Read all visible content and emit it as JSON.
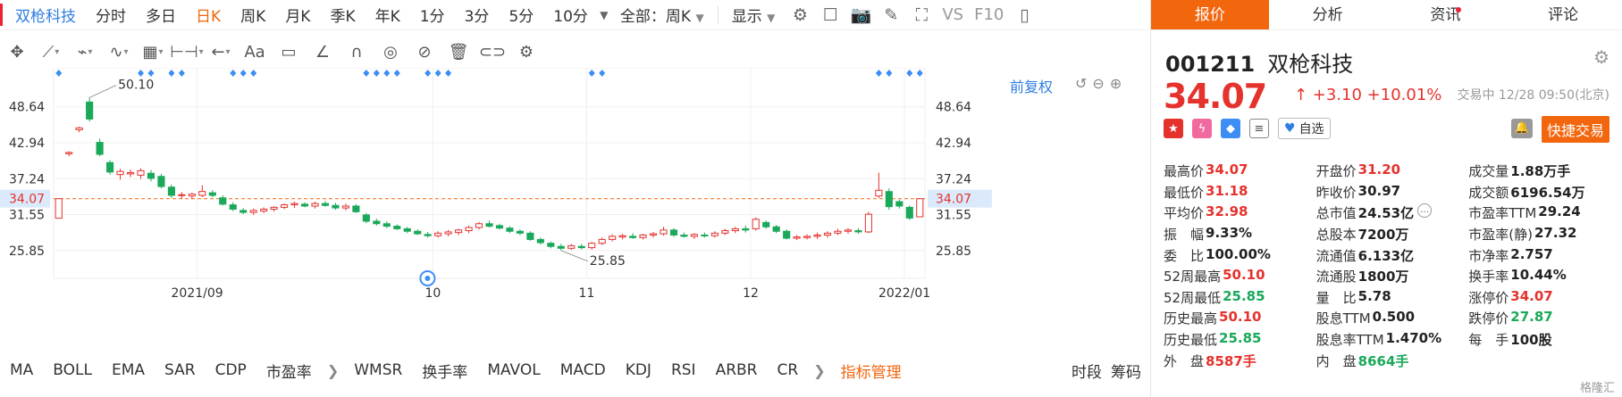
{
  "toolbar": {
    "stock_name": "双枪科技",
    "periods": [
      "分时",
      "多日",
      "日K",
      "周K",
      "月K",
      "季K",
      "年K",
      "1分",
      "3分",
      "5分",
      "10分"
    ],
    "active_period": "日K",
    "range": "全部：周K",
    "display": "显示",
    "vs": "VS",
    "f10": "F10"
  },
  "chart_options": {
    "adjust": "前复权"
  },
  "chart_data": {
    "type": "candlestick",
    "x_tick_labels": [
      "2021/09",
      "10",
      "11",
      "12",
      "2022/01"
    ],
    "y_tick_labels": [
      "48.64",
      "42.94",
      "37.24",
      "31.55",
      "25.85"
    ],
    "y_ticks": [
      48.64,
      42.94,
      37.24,
      31.55,
      25.85
    ],
    "ylim": [
      22.0,
      52.0
    ],
    "current_price_label": "34.07",
    "current_price": 34.07,
    "annotations": [
      {
        "text": "50.10",
        "value": 50.1
      },
      {
        "text": "25.85",
        "value": 25.85
      }
    ],
    "candles": [
      {
        "o": 30.97,
        "h": 34.07,
        "l": 30.97,
        "c": 34.07
      },
      {
        "o": 41.2,
        "h": 41.6,
        "l": 40.8,
        "c": 41.4
      },
      {
        "o": 45.0,
        "h": 45.5,
        "l": 44.6,
        "c": 45.3
      },
      {
        "o": 49.4,
        "h": 50.1,
        "l": 46.3,
        "c": 46.7
      },
      {
        "o": 43.0,
        "h": 43.6,
        "l": 40.8,
        "c": 41.1
      },
      {
        "o": 39.8,
        "h": 40.2,
        "l": 37.9,
        "c": 38.3
      },
      {
        "o": 37.9,
        "h": 38.8,
        "l": 37.1,
        "c": 38.4
      },
      {
        "o": 38.0,
        "h": 38.7,
        "l": 37.5,
        "c": 38.2
      },
      {
        "o": 37.8,
        "h": 38.9,
        "l": 37.2,
        "c": 38.5
      },
      {
        "o": 38.1,
        "h": 38.6,
        "l": 36.8,
        "c": 37.3
      },
      {
        "o": 37.6,
        "h": 38.0,
        "l": 35.7,
        "c": 36.0
      },
      {
        "o": 35.9,
        "h": 36.3,
        "l": 34.2,
        "c": 34.6
      },
      {
        "o": 34.6,
        "h": 35.1,
        "l": 34.1,
        "c": 34.7
      },
      {
        "o": 34.5,
        "h": 35.0,
        "l": 34.0,
        "c": 34.8
      },
      {
        "o": 34.6,
        "h": 36.2,
        "l": 34.3,
        "c": 35.2
      },
      {
        "o": 35.0,
        "h": 35.4,
        "l": 34.3,
        "c": 34.6
      },
      {
        "o": 34.2,
        "h": 34.6,
        "l": 33.0,
        "c": 33.2
      },
      {
        "o": 33.1,
        "h": 33.5,
        "l": 32.1,
        "c": 32.4
      },
      {
        "o": 32.2,
        "h": 32.6,
        "l": 31.6,
        "c": 31.9
      },
      {
        "o": 31.9,
        "h": 32.5,
        "l": 31.5,
        "c": 32.2
      },
      {
        "o": 32.1,
        "h": 32.7,
        "l": 31.8,
        "c": 32.4
      },
      {
        "o": 32.4,
        "h": 32.9,
        "l": 32.0,
        "c": 32.7
      },
      {
        "o": 32.7,
        "h": 33.3,
        "l": 32.4,
        "c": 33.1
      },
      {
        "o": 33.1,
        "h": 33.6,
        "l": 32.6,
        "c": 33.3
      },
      {
        "o": 33.2,
        "h": 33.5,
        "l": 32.7,
        "c": 32.9
      },
      {
        "o": 32.9,
        "h": 33.6,
        "l": 32.5,
        "c": 33.3
      },
      {
        "o": 33.3,
        "h": 33.7,
        "l": 32.8,
        "c": 33.0
      },
      {
        "o": 33.0,
        "h": 33.4,
        "l": 32.3,
        "c": 32.6
      },
      {
        "o": 32.6,
        "h": 33.3,
        "l": 32.2,
        "c": 32.9
      },
      {
        "o": 32.9,
        "h": 33.2,
        "l": 31.8,
        "c": 32.0
      },
      {
        "o": 31.5,
        "h": 31.8,
        "l": 30.2,
        "c": 30.5
      },
      {
        "o": 30.5,
        "h": 30.9,
        "l": 29.8,
        "c": 30.1
      },
      {
        "o": 30.1,
        "h": 30.5,
        "l": 29.4,
        "c": 29.7
      },
      {
        "o": 29.7,
        "h": 30.0,
        "l": 29.1,
        "c": 29.3
      },
      {
        "o": 29.3,
        "h": 29.6,
        "l": 28.6,
        "c": 28.9
      },
      {
        "o": 28.9,
        "h": 29.2,
        "l": 28.3,
        "c": 28.5
      },
      {
        "o": 28.4,
        "h": 28.8,
        "l": 27.9,
        "c": 28.2
      },
      {
        "o": 28.2,
        "h": 28.9,
        "l": 27.9,
        "c": 28.6
      },
      {
        "o": 28.5,
        "h": 29.1,
        "l": 28.1,
        "c": 28.8
      },
      {
        "o": 28.7,
        "h": 29.3,
        "l": 28.3,
        "c": 29.1
      },
      {
        "o": 29.0,
        "h": 29.8,
        "l": 28.6,
        "c": 29.5
      },
      {
        "o": 29.5,
        "h": 30.4,
        "l": 29.2,
        "c": 30.1
      },
      {
        "o": 30.1,
        "h": 30.6,
        "l": 29.5,
        "c": 29.7
      },
      {
        "o": 29.8,
        "h": 30.1,
        "l": 29.2,
        "c": 29.4
      },
      {
        "o": 29.4,
        "h": 29.7,
        "l": 28.6,
        "c": 28.9
      },
      {
        "o": 28.9,
        "h": 29.2,
        "l": 28.3,
        "c": 28.6
      },
      {
        "o": 28.6,
        "h": 28.9,
        "l": 27.4,
        "c": 27.6
      },
      {
        "o": 27.6,
        "h": 27.9,
        "l": 26.8,
        "c": 27.1
      },
      {
        "o": 27.0,
        "h": 27.3,
        "l": 26.2,
        "c": 26.5
      },
      {
        "o": 26.5,
        "h": 26.9,
        "l": 25.85,
        "c": 26.2
      },
      {
        "o": 26.2,
        "h": 26.9,
        "l": 25.9,
        "c": 26.6
      },
      {
        "o": 26.5,
        "h": 26.9,
        "l": 26.0,
        "c": 26.3
      },
      {
        "o": 26.3,
        "h": 27.2,
        "l": 26.0,
        "c": 27.0
      },
      {
        "o": 27.0,
        "h": 27.9,
        "l": 26.7,
        "c": 27.6
      },
      {
        "o": 27.6,
        "h": 28.4,
        "l": 27.3,
        "c": 28.1
      },
      {
        "o": 28.0,
        "h": 28.5,
        "l": 27.6,
        "c": 28.2
      },
      {
        "o": 28.1,
        "h": 28.6,
        "l": 27.7,
        "c": 27.9
      },
      {
        "o": 27.9,
        "h": 28.5,
        "l": 27.6,
        "c": 28.3
      },
      {
        "o": 28.3,
        "h": 28.8,
        "l": 27.9,
        "c": 28.5
      },
      {
        "o": 28.5,
        "h": 29.6,
        "l": 28.2,
        "c": 29.1
      },
      {
        "o": 29.1,
        "h": 29.4,
        "l": 28.0,
        "c": 28.3
      },
      {
        "o": 28.3,
        "h": 28.7,
        "l": 27.9,
        "c": 28.1
      },
      {
        "o": 28.1,
        "h": 28.6,
        "l": 27.7,
        "c": 28.4
      },
      {
        "o": 28.3,
        "h": 28.7,
        "l": 27.9,
        "c": 28.2
      },
      {
        "o": 28.2,
        "h": 28.9,
        "l": 27.9,
        "c": 28.6
      },
      {
        "o": 28.6,
        "h": 29.3,
        "l": 28.3,
        "c": 29.0
      },
      {
        "o": 29.0,
        "h": 29.6,
        "l": 28.6,
        "c": 29.3
      },
      {
        "o": 29.3,
        "h": 29.8,
        "l": 28.7,
        "c": 29.1
      },
      {
        "o": 29.3,
        "h": 31.1,
        "l": 29.0,
        "c": 30.8
      },
      {
        "o": 30.3,
        "h": 30.6,
        "l": 29.3,
        "c": 29.6
      },
      {
        "o": 29.6,
        "h": 29.9,
        "l": 28.6,
        "c": 28.9
      },
      {
        "o": 28.9,
        "h": 29.2,
        "l": 27.6,
        "c": 27.8
      },
      {
        "o": 27.8,
        "h": 28.3,
        "l": 27.5,
        "c": 28.0
      },
      {
        "o": 27.9,
        "h": 28.4,
        "l": 27.6,
        "c": 28.1
      },
      {
        "o": 28.1,
        "h": 28.7,
        "l": 27.7,
        "c": 28.3
      },
      {
        "o": 28.3,
        "h": 28.9,
        "l": 27.9,
        "c": 28.6
      },
      {
        "o": 28.6,
        "h": 29.3,
        "l": 28.3,
        "c": 28.9
      },
      {
        "o": 28.9,
        "h": 29.4,
        "l": 28.5,
        "c": 29.1
      },
      {
        "o": 29.0,
        "h": 29.4,
        "l": 28.5,
        "c": 28.8
      },
      {
        "o": 28.8,
        "h": 32.0,
        "l": 28.6,
        "c": 31.6
      },
      {
        "o": 34.5,
        "h": 38.2,
        "l": 34.2,
        "c": 35.4
      },
      {
        "o": 35.2,
        "h": 35.7,
        "l": 32.3,
        "c": 32.8
      },
      {
        "o": 33.6,
        "h": 33.9,
        "l": 32.5,
        "c": 32.9
      },
      {
        "o": 32.7,
        "h": 33.0,
        "l": 30.7,
        "c": 31.0
      },
      {
        "o": 31.2,
        "h": 34.07,
        "l": 31.18,
        "c": 34.07
      }
    ],
    "marker_positions": [
      0,
      8,
      9,
      11,
      12,
      17,
      18,
      19,
      30,
      31,
      32,
      33,
      36,
      37,
      38,
      52,
      53,
      80,
      81,
      83,
      84
    ]
  },
  "indicators": [
    "MA",
    "BOLL",
    "EMA",
    "SAR",
    "CDP",
    "市盈率",
    "WMSR",
    "换手率",
    "MAVOL",
    "MACD",
    "KDJ",
    "RSI",
    "ARBR",
    "CR"
  ],
  "indicator_mgmt": "指标管理",
  "indicator_right": [
    "时段",
    "筹码"
  ],
  "panel": {
    "tabs": [
      "报价",
      "分析",
      "资讯",
      "评论"
    ],
    "active_tab": "报价",
    "code": "001211",
    "name": "双枪科技",
    "price": "34.07",
    "change": "↑ +3.10 +10.01%",
    "status_time": "交易中 12/28 09:50(北京)",
    "self_select": "自选",
    "quick_trade": "快捷交易",
    "rows": [
      [
        {
          "label": "最高价",
          "value": "34.07",
          "color": "red"
        },
        {
          "label": "开盘价",
          "value": "31.20",
          "color": "red"
        },
        {
          "label": "成交量",
          "value": "1.88万手",
          "color": ""
        }
      ],
      [
        {
          "label": "最低价",
          "value": "31.18",
          "color": "red"
        },
        {
          "label": "昨收价",
          "value": "30.97",
          "color": ""
        },
        {
          "label": "成交额",
          "value": "6196.54万",
          "color": ""
        }
      ],
      [
        {
          "label": "平均价",
          "value": "32.98",
          "color": "red"
        },
        {
          "label": "总市值",
          "value": "24.53亿",
          "color": ""
        },
        {
          "label": "市盈率TTM",
          "value": "29.24",
          "color": ""
        }
      ],
      [
        {
          "label": "振　幅",
          "value": "9.33%",
          "color": ""
        },
        {
          "label": "总股本",
          "value": "7200万",
          "color": ""
        },
        {
          "label": "市盈率(静)",
          "value": "27.32",
          "color": ""
        }
      ],
      [
        {
          "label": "委　比",
          "value": "100.00%",
          "color": ""
        },
        {
          "label": "流通值",
          "value": "6.133亿",
          "color": ""
        },
        {
          "label": "市净率",
          "value": "2.757",
          "color": ""
        }
      ],
      [
        {
          "label": "52周最高",
          "value": "50.10",
          "color": "red"
        },
        {
          "label": "流通股",
          "value": "1800万",
          "color": ""
        },
        {
          "label": "换手率",
          "value": "10.44%",
          "color": ""
        }
      ],
      [
        {
          "label": "52周最低",
          "value": "25.85",
          "color": "green"
        },
        {
          "label": "量　比",
          "value": "5.78",
          "color": ""
        },
        {
          "label": "涨停价",
          "value": "34.07",
          "color": "red"
        }
      ],
      [
        {
          "label": "历史最高",
          "value": "50.10",
          "color": "red"
        },
        {
          "label": "股息TTM",
          "value": "0.500",
          "color": ""
        },
        {
          "label": "跌停价",
          "value": "27.87",
          "color": "green"
        }
      ],
      [
        {
          "label": "历史最低",
          "value": "25.85",
          "color": "green"
        },
        {
          "label": "股息率TTM",
          "value": "1.470%",
          "color": ""
        },
        {
          "label": "每　手",
          "value": "100股",
          "color": ""
        }
      ],
      [
        {
          "label": "外　盘",
          "value": "8587手",
          "color": "red"
        },
        {
          "label": "内　盘",
          "value": "8664手",
          "color": "green"
        },
        {
          "label": "",
          "value": "",
          "color": ""
        }
      ]
    ],
    "watermark": "格隆汇"
  },
  "colors": {
    "up": "#e5322d",
    "down": "#1aa85a",
    "accent": "#f2660d",
    "link": "#2f7de1",
    "marker": "#3d8df5"
  }
}
